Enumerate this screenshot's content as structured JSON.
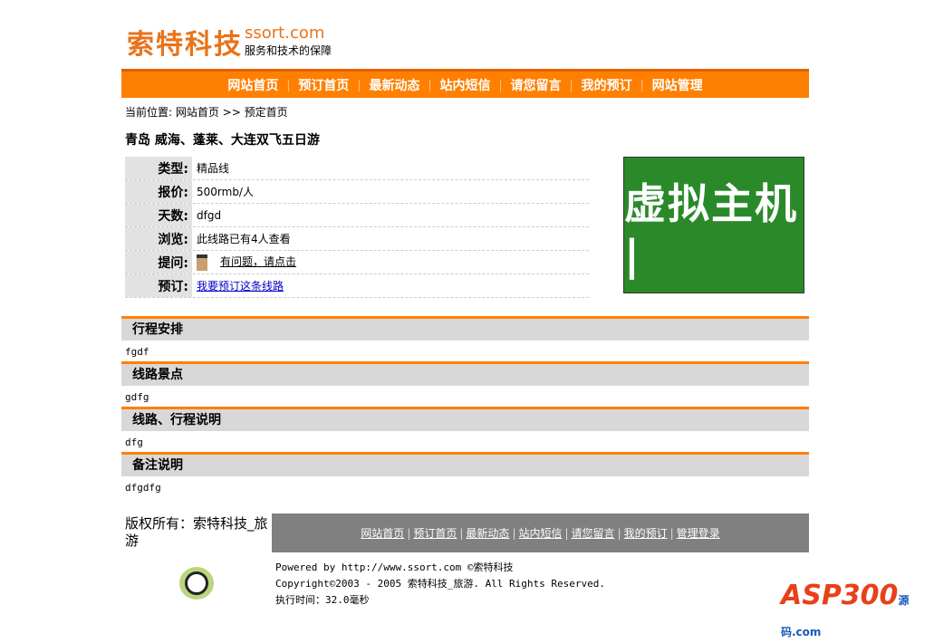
{
  "header": {
    "logo_cn": "索特科技",
    "logo_en": "ssort.com",
    "slogan": "服务和技术的保障"
  },
  "nav": [
    "网站首页",
    "预订首页",
    "最新动态",
    "站内短信",
    "请您留言",
    "我的预订",
    "网站管理"
  ],
  "breadcrumb": "当前位置: 网站首页 >> 预定首页",
  "title": "青岛 威海、蓬莱、大连双飞五日游",
  "info": [
    {
      "label": "类型:",
      "value": "精品线"
    },
    {
      "label": "报价:",
      "value": "500rmb/人"
    },
    {
      "label": "天数:",
      "value": "dfgd"
    },
    {
      "label": "浏览:",
      "value": "此线路已有4人查看"
    },
    {
      "label": "提问:",
      "value": "有问题，请点击"
    },
    {
      "label": "预订:",
      "value": "我要预订这条线路"
    }
  ],
  "ad": "虚拟主机 |",
  "sections": [
    {
      "title": "行程安排",
      "content": "fgdf"
    },
    {
      "title": "线路景点",
      "content": "gdfg"
    },
    {
      "title": "线路、行程说明",
      "content": "dfg"
    },
    {
      "title": "备注说明",
      "content": "dfgdfg"
    }
  ],
  "footer": {
    "copyright": "版权所有：索特科技_旅游",
    "links": [
      "网站首页",
      "预订首页",
      "最新动态",
      "站内短信",
      "请您留言",
      "我的预订",
      "管理登录"
    ],
    "powered": "Powered by http://www.ssort.com ©索特科技",
    "copy_line": "Copyright©2003 - 2005 索特科技_旅游. All Rights Reserved.",
    "exec_time": "执行时间：32.0毫秒",
    "watermark": "ASP300源码.com"
  },
  "colors": {
    "accent": "#ff7f00",
    "footer_bg": "#808080",
    "ad_bg": "#2a8a2a"
  }
}
